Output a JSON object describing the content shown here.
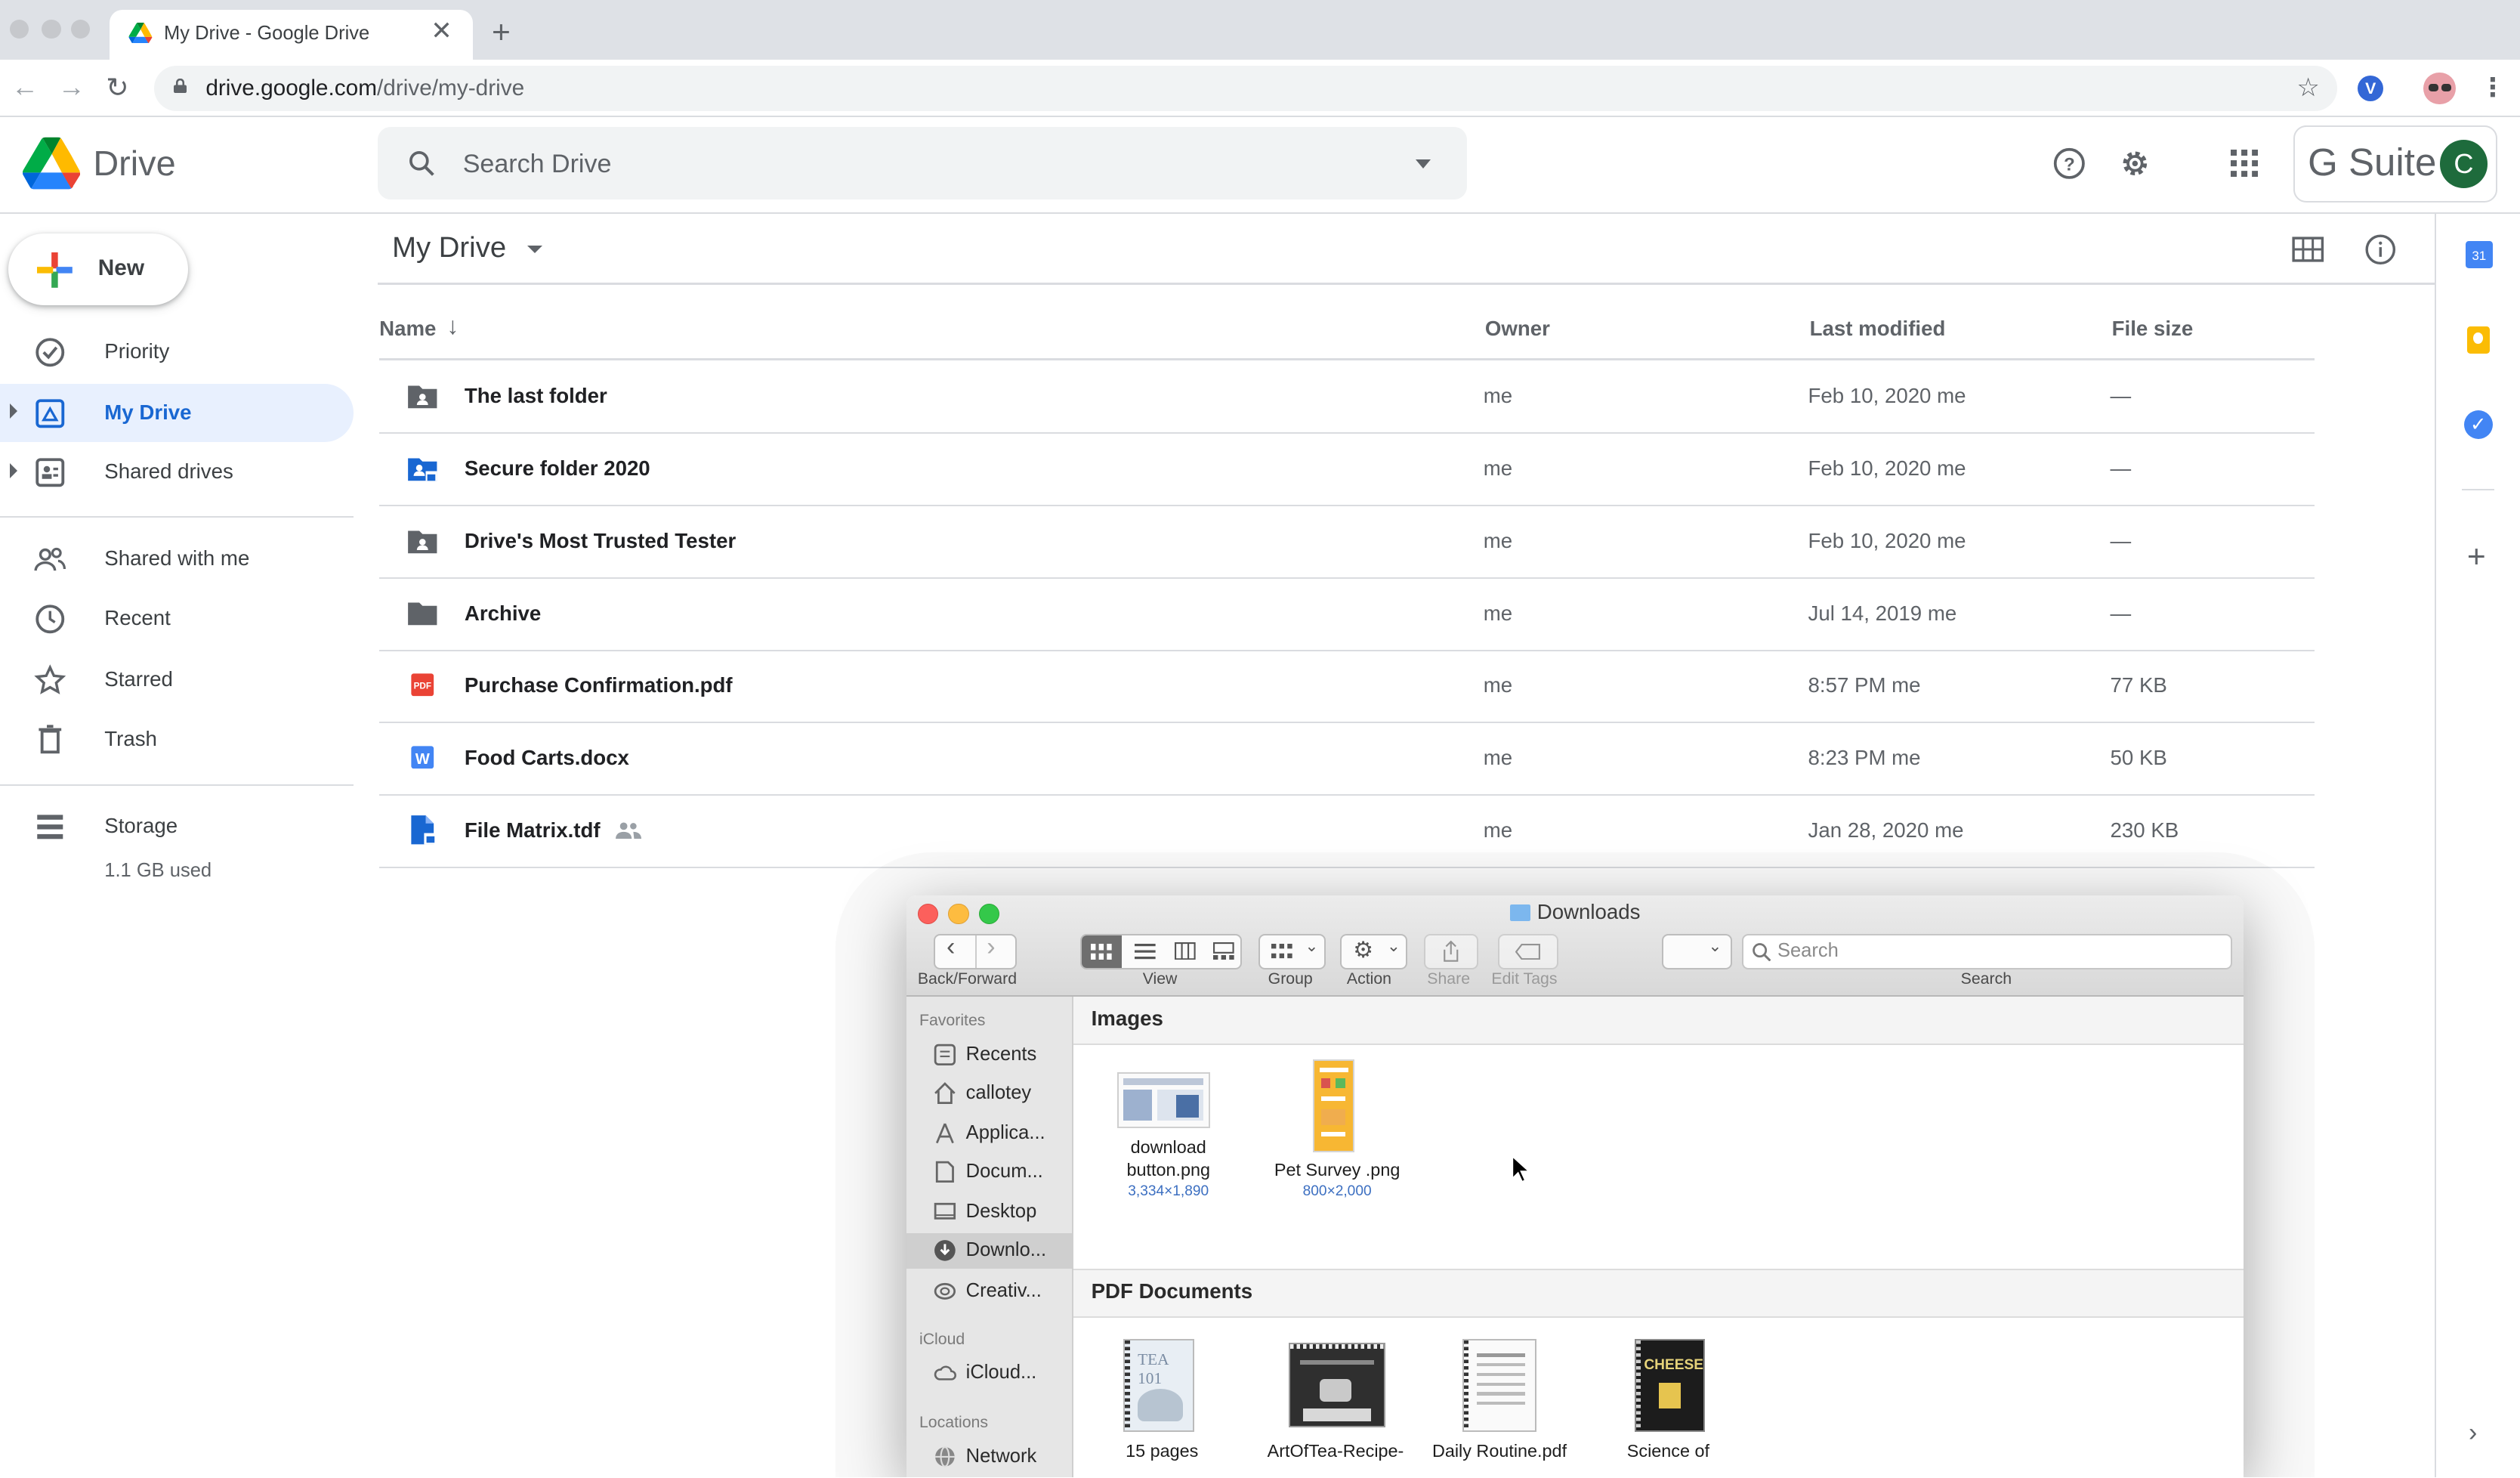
{
  "browser": {
    "tab_title": "My Drive - Google Drive",
    "url_host": "drive.google.com",
    "url_path": "/drive/my-drive"
  },
  "drive": {
    "product": "Drive",
    "search_placeholder": "Search Drive",
    "gsuite_label": "G Suite",
    "avatar_letter": "C",
    "new_label": "New",
    "breadcrumb": "My Drive"
  },
  "sidebar": {
    "items": [
      {
        "label": "Priority",
        "icon": "priority-check-icon"
      },
      {
        "label": "My Drive",
        "icon": "my-drive-icon",
        "active": true
      },
      {
        "label": "Shared drives",
        "icon": "shared-drives-icon"
      },
      {
        "label": "Shared with me",
        "icon": "people-icon"
      },
      {
        "label": "Recent",
        "icon": "clock-icon"
      },
      {
        "label": "Starred",
        "icon": "star-icon"
      },
      {
        "label": "Trash",
        "icon": "trash-icon"
      }
    ],
    "storage_label": "Storage",
    "storage_used": "1.1 GB used"
  },
  "table": {
    "columns": {
      "name": "Name",
      "owner": "Owner",
      "modified": "Last modified",
      "size": "File size"
    },
    "rows": [
      {
        "name": "The last folder",
        "icon": "shared-folder-icon",
        "owner": "me",
        "modified": "Feb 10, 2020",
        "modified_by": "me",
        "size": "—"
      },
      {
        "name": "Secure folder 2020",
        "icon": "secure-shared-folder-icon",
        "owner": "me",
        "modified": "Feb 10, 2020",
        "modified_by": "me",
        "size": "—"
      },
      {
        "name": "Drive's Most Trusted Tester",
        "icon": "shared-folder-icon",
        "owner": "me",
        "modified": "Feb 10, 2020",
        "modified_by": "me",
        "size": "—"
      },
      {
        "name": "Archive",
        "icon": "folder-icon",
        "owner": "me",
        "modified": "Jul 14, 2019",
        "modified_by": "me",
        "size": "—"
      },
      {
        "name": "Purchase Confirmation.pdf",
        "icon": "pdf-icon",
        "owner": "me",
        "modified": "8:57 PM",
        "modified_by": "me",
        "size": "77 KB"
      },
      {
        "name": "Food Carts.docx",
        "icon": "word-doc-icon",
        "owner": "me",
        "modified": "8:23 PM",
        "modified_by": "me",
        "size": "50 KB"
      },
      {
        "name": "File Matrix.tdf",
        "icon": "secure-file-icon",
        "owner": "me",
        "modified": "Jan 28, 2020",
        "modified_by": "me",
        "size": "230 KB"
      }
    ]
  },
  "finder": {
    "title": "Downloads",
    "toolbar": {
      "back_forward": "Back/Forward",
      "view": "View",
      "group": "Group",
      "action": "Action",
      "share": "Share",
      "edit_tags": "Edit Tags",
      "search_placeholder": "Search",
      "search_caption": "Search"
    },
    "sidebar": {
      "favorites_label": "Favorites",
      "favorites": [
        {
          "label": "Recents",
          "icon": "recents-icon"
        },
        {
          "label": "callotey",
          "icon": "home-icon"
        },
        {
          "label": "Applica...",
          "icon": "applications-icon"
        },
        {
          "label": "Docum...",
          "icon": "documents-icon"
        },
        {
          "label": "Desktop",
          "icon": "desktop-icon"
        },
        {
          "label": "Downlo...",
          "icon": "downloads-icon",
          "selected": true
        },
        {
          "label": "Creativ...",
          "icon": "creative-cloud-icon"
        }
      ],
      "icloud_label": "iCloud",
      "icloud": [
        {
          "label": "iCloud...",
          "icon": "icloud-icon"
        }
      ],
      "locations_label": "Locations",
      "locations": [
        {
          "label": "Network",
          "icon": "network-icon"
        }
      ]
    },
    "groups": [
      {
        "label": "Images",
        "files": [
          {
            "name_line1": "download",
            "name_line2": "button.png",
            "dims": "3,334×1,890"
          },
          {
            "name_line1": "Pet Survey .png",
            "name_line2": "",
            "dims": "800×2,000"
          }
        ]
      },
      {
        "label": "PDF Documents",
        "files": [
          {
            "name_line1": "15 pages",
            "thumb_text": "TEA 101"
          },
          {
            "name_line1": "ArtOfTea-Recipe-"
          },
          {
            "name_line1": "Daily Routine.pdf"
          },
          {
            "name_line1": "Science of",
            "thumb_text": "CHEESE"
          }
        ]
      }
    ]
  },
  "colors": {
    "accent_blue": "#1967d2",
    "active_bg": "#e8f0fe",
    "pdf_red": "#ea4335",
    "word_blue": "#4285f4"
  }
}
